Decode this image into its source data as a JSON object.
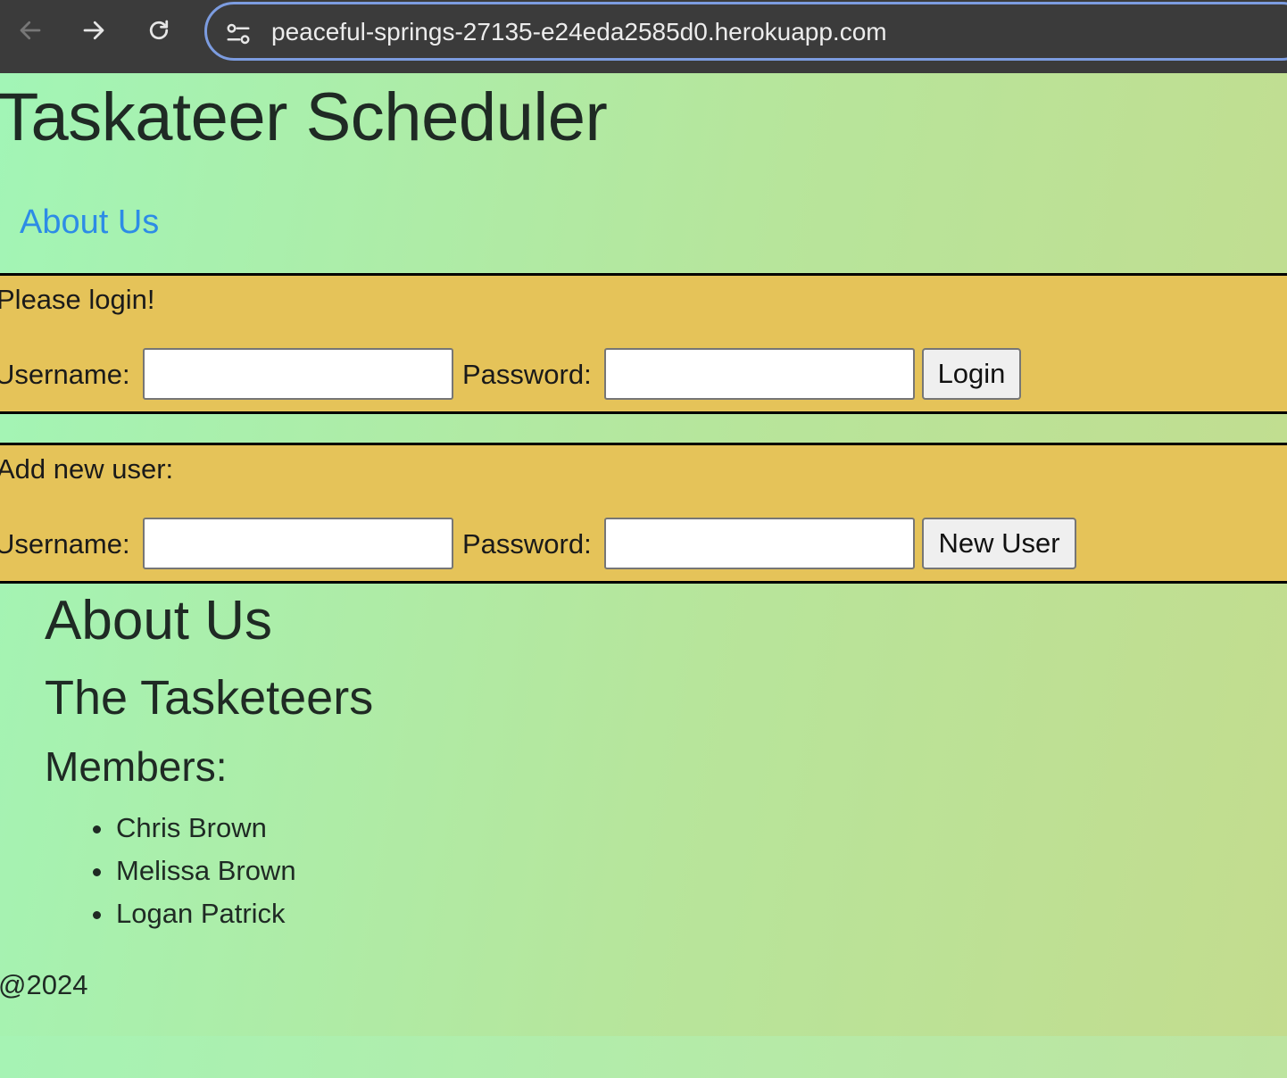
{
  "browser": {
    "url": "peaceful-springs-27135-e24eda2585d0.herokuapp.com",
    "back_icon": "arrow-left-icon",
    "forward_icon": "arrow-right-icon",
    "reload_icon": "reload-icon",
    "site_info_icon": "tune-icon"
  },
  "header": {
    "title": "Taskateer Scheduler",
    "nav_about": "About Us"
  },
  "login": {
    "heading": "Please login!",
    "username_label": "Username:",
    "password_label": "Password:",
    "username_value": "",
    "password_value": "",
    "submit_label": "Login"
  },
  "register": {
    "heading": "Add new user:",
    "username_label": "Username:",
    "password_label": "Password:",
    "username_value": "",
    "password_value": "",
    "submit_label": "New User"
  },
  "about": {
    "title": "About Us",
    "team_name": "The Tasketeers",
    "members_heading": "Members:",
    "members": [
      "Chris Brown",
      "Melissa Brown",
      "Logan Patrick"
    ]
  },
  "footer": {
    "text": "@2024"
  },
  "colors": {
    "panel_bg": "#e5c359",
    "link": "#2d8ce6",
    "page_gradient_start": "#a2f5b6",
    "page_gradient_end": "#c3dc8e"
  }
}
